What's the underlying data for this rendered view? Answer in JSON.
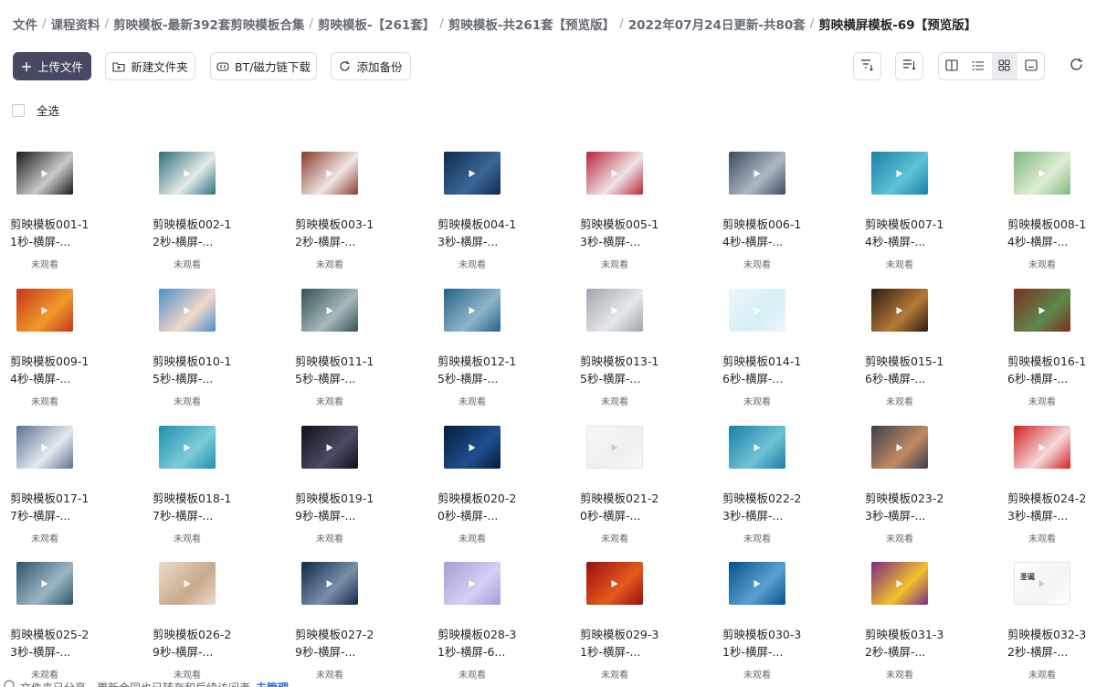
{
  "breadcrumb": [
    "文件",
    "课程资料",
    "剪映模板-最新392套剪映模板合集",
    "剪映模板-【261套】",
    "剪映模板-共261套【预览版】",
    "2022年07月24日更新-共80套",
    "剪映横屏模板-69【预览版】"
  ],
  "toolbar": {
    "upload": "上传文件",
    "new_folder": "新建文件夹",
    "bt_download": "BT/磁力链下载",
    "add_backup": "添加备份"
  },
  "select_all": "全选",
  "files": [
    {
      "name": "剪映模板001-11秒-横屏-...",
      "status": "未观看",
      "thumb": [
        "#1a1a1a",
        "#c9c9c9"
      ]
    },
    {
      "name": "剪映模板002-12秒-横屏-...",
      "status": "未观看",
      "thumb": [
        "#2e6f7a",
        "#e3ebe9"
      ]
    },
    {
      "name": "剪映模板003-12秒-横屏-...",
      "status": "未观看",
      "thumb": [
        "#8a3b2c",
        "#efe6e2"
      ]
    },
    {
      "name": "剪映模板004-13秒-横屏-...",
      "status": "未观看",
      "thumb": [
        "#0f2c4f",
        "#3a6796"
      ]
    },
    {
      "name": "剪映模板005-13秒-横屏-...",
      "status": "未观看",
      "thumb": [
        "#b8243a",
        "#f1e4e6"
      ]
    },
    {
      "name": "剪映模板006-14秒-横屏-...",
      "status": "未观看",
      "thumb": [
        "#3d4c5c",
        "#aeb9c4"
      ]
    },
    {
      "name": "剪映模板007-14秒-横屏-...",
      "status": "未观看",
      "thumb": [
        "#1a7fa7",
        "#5fc3d5"
      ]
    },
    {
      "name": "剪映模板008-14秒-横屏-...",
      "status": "未观看",
      "thumb": [
        "#7fb77e",
        "#dfeed5"
      ]
    },
    {
      "name": "剪映模板009-14秒-横屏-...",
      "status": "未观看",
      "thumb": [
        "#c4361a",
        "#f09a2a"
      ]
    },
    {
      "name": "剪映模板010-15秒-横屏-...",
      "status": "未观看",
      "thumb": [
        "#4a8ec9",
        "#f2d9c9"
      ]
    },
    {
      "name": "剪映模板011-15秒-横屏-...",
      "status": "未观看",
      "thumb": [
        "#355057",
        "#a7b9bb"
      ]
    },
    {
      "name": "剪映模板012-15秒-横屏-...",
      "status": "未观看",
      "thumb": [
        "#25618a",
        "#8fb5c9"
      ]
    },
    {
      "name": "剪映模板013-15秒-横屏-...",
      "status": "未观看",
      "thumb": [
        "#9fa5ab",
        "#e6e8ea"
      ]
    },
    {
      "name": "剪映模板014-16秒-横屏-...",
      "status": "未观看",
      "thumb": [
        "#eef7fb",
        "#d6eef7"
      ]
    },
    {
      "name": "剪映模板015-16秒-横屏-...",
      "status": "未观看",
      "thumb": [
        "#2b1d12",
        "#b57a37"
      ]
    },
    {
      "name": "剪映模板016-16秒-横屏-...",
      "status": "未观看",
      "thumb": [
        "#7a2f22",
        "#5d8a4a"
      ]
    },
    {
      "name": "剪映模板017-17秒-横屏-...",
      "status": "未观看",
      "thumb": [
        "#5d7090",
        "#e4e9ef"
      ]
    },
    {
      "name": "剪映模板018-17秒-横屏-...",
      "status": "未观看",
      "thumb": [
        "#1c90ad",
        "#7fcbd8"
      ]
    },
    {
      "name": "剪映模板019-19秒-横屏-...",
      "status": "未观看",
      "thumb": [
        "#101018",
        "#4a4c66"
      ]
    },
    {
      "name": "剪映模板020-20秒-横屏-...",
      "status": "未观看",
      "thumb": [
        "#071c3c",
        "#1f4f8f"
      ]
    },
    {
      "name": "剪映模板021-20秒-横屏-...",
      "status": "未观看",
      "thumb": [
        "#f7f7f7",
        "#efefef"
      ]
    },
    {
      "name": "剪映模板022-23秒-横屏-...",
      "status": "未观看",
      "thumb": [
        "#1a7fa7",
        "#6ec2d3"
      ]
    },
    {
      "name": "剪映模板023-23秒-横屏-...",
      "status": "未观看",
      "thumb": [
        "#3a3f4a",
        "#c28a64"
      ]
    },
    {
      "name": "剪映模板024-23秒-横屏-...",
      "status": "未观看",
      "thumb": [
        "#d21f22",
        "#f5dada"
      ]
    },
    {
      "name": "剪映模板025-23秒-横屏-...",
      "status": "未观看",
      "thumb": [
        "#2e5468",
        "#9bb6c3"
      ]
    },
    {
      "name": "剪映模板026-29秒-横屏-...",
      "status": "未观看",
      "thumb": [
        "#e8dccb",
        "#c9a98a"
      ]
    },
    {
      "name": "剪映模板027-29秒-横屏-...",
      "status": "未观看",
      "thumb": [
        "#12284a",
        "#7b8fa9"
      ]
    },
    {
      "name": "剪映模板028-31秒-横屏-6...",
      "status": "未观看",
      "thumb": [
        "#a79cd9",
        "#d6cff2"
      ]
    },
    {
      "name": "剪映模板029-31秒-横屏-...",
      "status": "未观看",
      "thumb": [
        "#9a0f12",
        "#e55a1c"
      ]
    },
    {
      "name": "剪映模板030-31秒-横屏-...",
      "status": "未观看",
      "thumb": [
        "#08508c",
        "#5aa1d2"
      ]
    },
    {
      "name": "剪映模板031-32秒-横屏-...",
      "status": "未观看",
      "thumb": [
        "#7a2a86",
        "#f3c12a"
      ]
    },
    {
      "name": "剪映模板032-32秒-横屏-...",
      "status": "未观看",
      "thumb": [
        "#ffffff",
        "#f4f4f4"
      ],
      "thumb_text": "圣诞"
    }
  ],
  "footer": {
    "text": "文件夹已分享，更新合同也已转存和后续访问者",
    "link": "去管理"
  }
}
